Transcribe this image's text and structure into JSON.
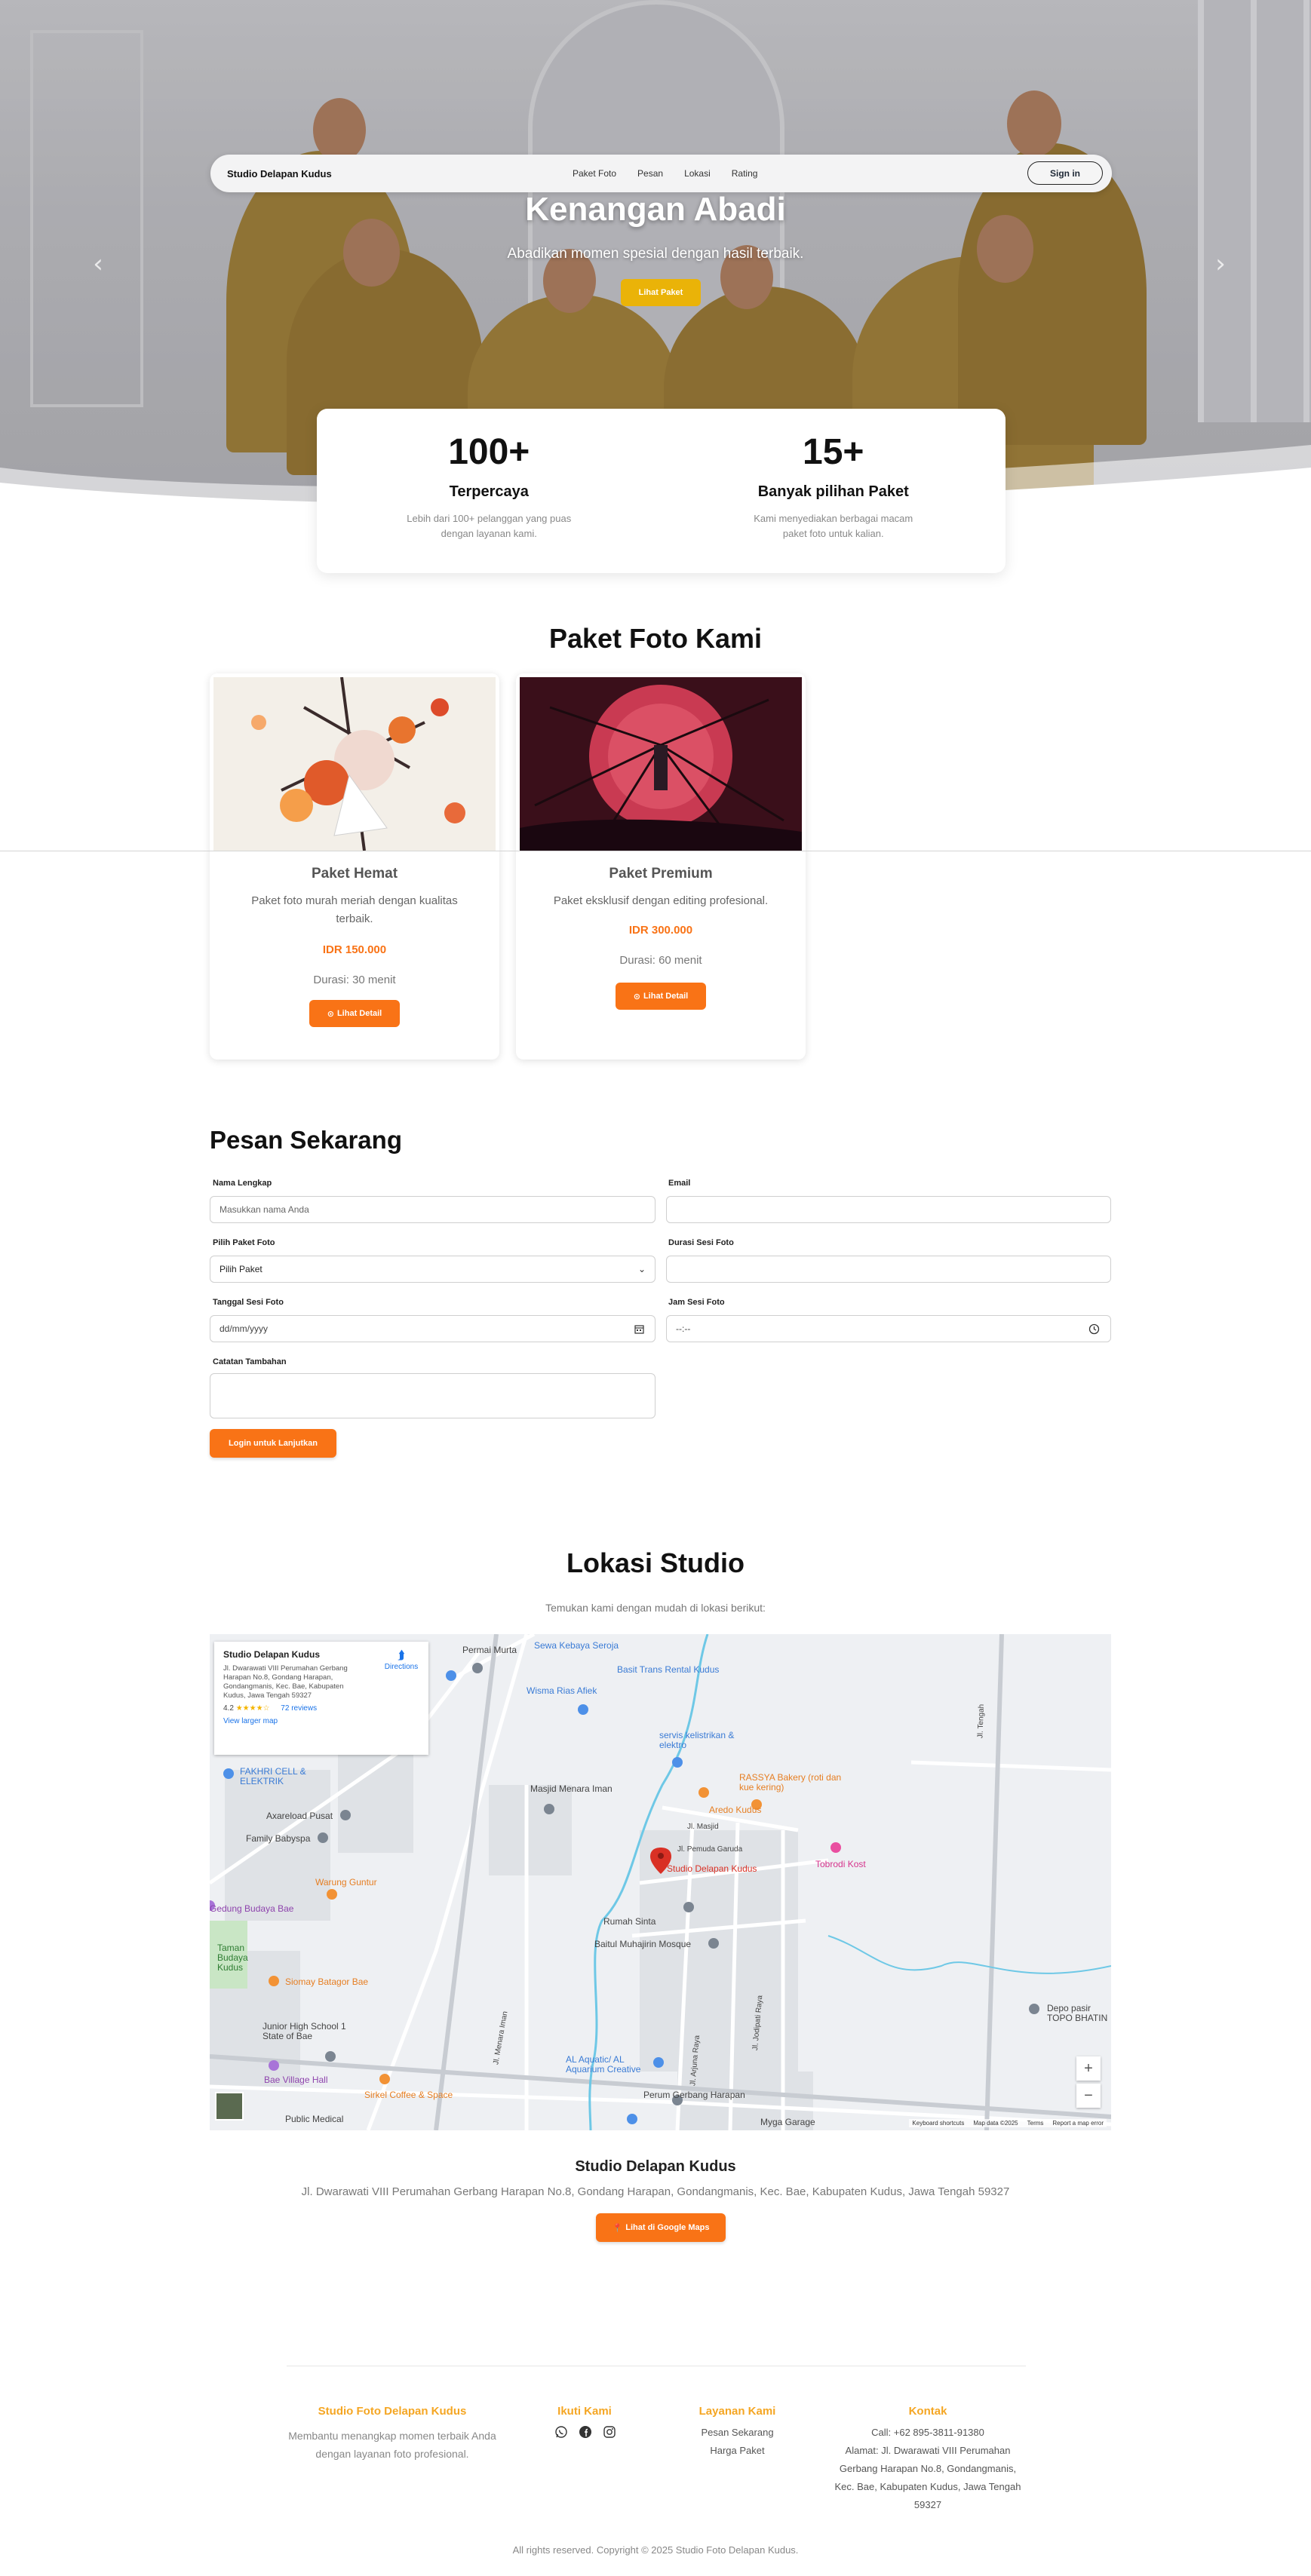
{
  "navbar": {
    "brand": "Studio Delapan Kudus",
    "links": [
      "Paket Foto",
      "Pesan",
      "Lokasi",
      "Rating"
    ],
    "signin": "Sign in"
  },
  "hero": {
    "title": "Kenangan Abadi",
    "subtitle": "Abadikan momen spesial dengan hasil terbaik.",
    "button": "Lihat Paket",
    "prev_icon": "chevron-left-icon",
    "next_icon": "chevron-right-icon"
  },
  "stats": [
    {
      "number": "100+",
      "label": "Terpercaya",
      "desc": "Lebih dari 100+ pelanggan yang puas dengan layanan kami."
    },
    {
      "number": "15+",
      "label": "Banyak pilihan Paket",
      "desc": "Kami menyediakan berbagai macam paket foto untuk kalian."
    }
  ],
  "packages": {
    "title": "Paket Foto Kami",
    "items": [
      {
        "name": "Paket Hemat",
        "desc": "Paket foto murah meriah dengan kualitas terbaik.",
        "price": "IDR 150.000",
        "duration": "Durasi: 30 menit",
        "button": "Lihat Detail"
      },
      {
        "name": "Paket Premium",
        "desc": "Paket eksklusif dengan editing profesional.",
        "price": "IDR 300.000",
        "duration": "Durasi: 60 menit",
        "button": "Lihat Detail"
      }
    ]
  },
  "form": {
    "title": "Pesan Sekarang",
    "name_label": "Nama Lengkap",
    "name_placeholder": "Masukkan nama Anda",
    "email_label": "Email",
    "package_label": "Pilih Paket Foto",
    "package_selected": "Pilih Paket",
    "duration_label": "Durasi Sesi Foto",
    "date_label": "Tanggal Sesi Foto",
    "date_placeholder": "dd/mm/yyyy",
    "time_label": "Jam Sesi Foto",
    "time_placeholder": "--:--",
    "notes_label": "Catatan Tambahan",
    "submit": "Login untuk Lanjutkan"
  },
  "location": {
    "title": "Lokasi Studio",
    "subtitle": "Temukan kami dengan mudah di lokasi berikut:",
    "map": {
      "info_title": "Studio Delapan Kudus",
      "info_address": "Jl. Dwarawati VIII Perumahan Gerbang Harapan No.8, Gondang Harapan, Gondangmanis, Kec. Bae, Kabupaten Kudus, Jawa Tengah 59327",
      "directions": "Directions",
      "rating": "4.2",
      "stars": "★★★★☆",
      "reviews": "72 reviews",
      "view_larger": "View larger map",
      "pin_label": "Studio Delapan Kudus",
      "places": [
        "Permai Murta",
        "Sewa Kebaya Seroja",
        "Basit Trans Rental Kudus",
        "Wisma Rias Afiek",
        "servis kelistrikan & elektro",
        "FAKHRI CELL & ELEKTRIK",
        "RASSYA Bakery (roti dan kue kering)",
        "Masjid Menara Iman",
        "Aredo Kudus",
        "Axareload Pusat",
        "Family Babyspa",
        "Tobrodi Kost",
        "Warung Guntur",
        "Gedung Budaya Bae",
        "Rumah Sinta",
        "Baitul Muhajirin Mosque",
        "Taman Budaya Kudus",
        "Siomay Batagor Bae",
        "Depo pasir TOPO BHATIN",
        "Junior High School 1 State of Bae",
        "AL Aquatic/ AL Aquarium Creative",
        "Bae Village Hall",
        "Sirkel Coffee & Space",
        "Perum Gerbang Harapan",
        "Public Medical",
        "Myga Garage"
      ],
      "roads": [
        "Jl. Masjid",
        "Jl. Pemuda Garuda",
        "Jl. Tengah",
        "Jl. Menara Iman",
        "Jl. Arjuna Raya",
        "Jl. Jodipati Raya"
      ],
      "footer": [
        "Keyboard shortcuts",
        "Map data ©2025",
        "Terms",
        "Report a map error"
      ]
    },
    "name": "Studio Delapan Kudus",
    "address": "Jl. Dwarawati VIII Perumahan Gerbang Harapan No.8, Gondang Harapan, Gondangmanis, Kec. Bae, Kabupaten Kudus, Jawa Tengah 59327",
    "button": "Lihat di Google Maps"
  },
  "footer": {
    "about_title": "Studio Foto Delapan Kudus",
    "about_text": "Membantu menangkap momen terbaik Anda dengan layanan foto profesional.",
    "follow_title": "Ikuti Kami",
    "social_icons": [
      "whatsapp-icon",
      "facebook-icon",
      "instagram-icon"
    ],
    "services_title": "Layanan Kami",
    "services": [
      "Pesan Sekarang",
      "Harga Paket"
    ],
    "contact_title": "Kontak",
    "call": "Call: +62 895-3811-91380",
    "address": "Alamat: Jl. Dwarawati VIII Perumahan Gerbang Harapan No.8, Gondangmanis, Kec. Bae, Kabupaten Kudus, Jawa Tengah 59327",
    "copyright": "All rights reserved. Copyright © 2025 Studio Foto Delapan Kudus."
  },
  "colors": {
    "accent": "#f97316",
    "hero_button": "#eab308",
    "footer_title": "#f5a623"
  }
}
